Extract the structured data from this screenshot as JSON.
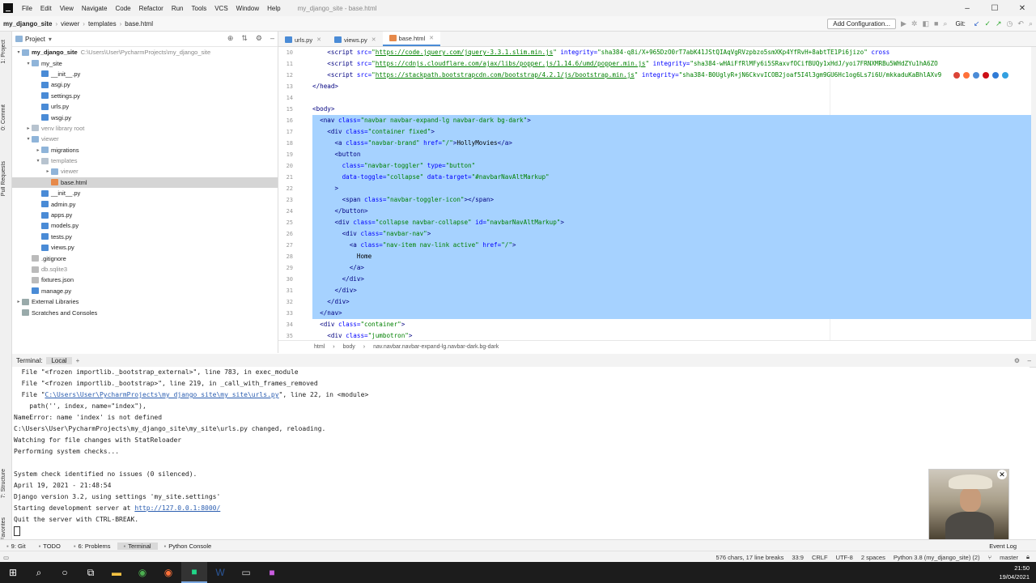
{
  "menubar": {
    "items": [
      "File",
      "Edit",
      "View",
      "Navigate",
      "Code",
      "Refactor",
      "Run",
      "Tools",
      "VCS",
      "Window",
      "Help"
    ],
    "window_title": "my_django_site - base.html"
  },
  "navbar": {
    "breadcrumbs": [
      "my_django_site",
      "viewer",
      "templates",
      "base.html"
    ],
    "add_config": "Add Configuration...",
    "git_label": "Git:"
  },
  "project_panel": {
    "title": "Project",
    "tree": [
      {
        "label": "my_django_site",
        "extra": "C:\\Users\\User\\PycharmProjects\\my_django_site",
        "indent": 0,
        "arrow": "▾",
        "icon": "folder",
        "bold": true
      },
      {
        "label": "my_site",
        "indent": 1,
        "arrow": "▾",
        "icon": "folder"
      },
      {
        "label": "__init__.py",
        "indent": 2,
        "arrow": "",
        "icon": "py"
      },
      {
        "label": "asgi.py",
        "indent": 2,
        "arrow": "",
        "icon": "py"
      },
      {
        "label": "settings.py",
        "indent": 2,
        "arrow": "",
        "icon": "py"
      },
      {
        "label": "urls.py",
        "indent": 2,
        "arrow": "",
        "icon": "py"
      },
      {
        "label": "wsgi.py",
        "indent": 2,
        "arrow": "",
        "icon": "py"
      },
      {
        "label": "venv library root",
        "indent": 1,
        "arrow": "▸",
        "icon": "folder grey",
        "muted": true
      },
      {
        "label": "viewer",
        "indent": 1,
        "arrow": "▾",
        "icon": "folder",
        "muted": true
      },
      {
        "label": "migrations",
        "indent": 2,
        "arrow": "▸",
        "icon": "folder"
      },
      {
        "label": "templates",
        "indent": 2,
        "arrow": "▾",
        "icon": "folder grey",
        "muted": true
      },
      {
        "label": "viewer",
        "indent": 3,
        "arrow": "▸",
        "icon": "folder",
        "muted": true
      },
      {
        "label": "base.html",
        "indent": 3,
        "arrow": "",
        "icon": "html",
        "selected": true
      },
      {
        "label": "__init__.py",
        "indent": 2,
        "arrow": "",
        "icon": "py"
      },
      {
        "label": "admin.py",
        "indent": 2,
        "arrow": "",
        "icon": "py"
      },
      {
        "label": "apps.py",
        "indent": 2,
        "arrow": "",
        "icon": "py"
      },
      {
        "label": "models.py",
        "indent": 2,
        "arrow": "",
        "icon": "py"
      },
      {
        "label": "tests.py",
        "indent": 2,
        "arrow": "",
        "icon": "py"
      },
      {
        "label": "views.py",
        "indent": 2,
        "arrow": "",
        "icon": "py"
      },
      {
        "label": ".gitignore",
        "indent": 1,
        "arrow": "",
        "icon": "file"
      },
      {
        "label": "db.sqlite3",
        "indent": 1,
        "arrow": "",
        "icon": "file",
        "muted": true
      },
      {
        "label": "fixtures.json",
        "indent": 1,
        "arrow": "",
        "icon": "file"
      },
      {
        "label": "manage.py",
        "indent": 1,
        "arrow": "",
        "icon": "py"
      },
      {
        "label": "External Libraries",
        "indent": 0,
        "arrow": "▸",
        "icon": "lib"
      },
      {
        "label": "Scratches and Consoles",
        "indent": 0,
        "arrow": "",
        "icon": "lib"
      }
    ]
  },
  "editor": {
    "tabs": [
      {
        "label": "urls.py",
        "active": false
      },
      {
        "label": "views.py",
        "active": false
      },
      {
        "label": "base.html",
        "active": true
      }
    ],
    "lines": [
      {
        "n": "10",
        "sel": false,
        "html": "    <span class='tag'>&lt;script </span><span class='attr'>src=</span><span class='str'>\"</span><span class='link'>https://code.jquery.com/jquery-3.3.1.slim.min.js</span><span class='str'>\"</span><span class='attr'> integrity=</span><span class='str'>\"sha384-q8i/X+965DzO0rT7abK41JStQIAqVgRVzpbzo5smXKp4YfRvH+8abtTE1Pi6jizo\"</span><span class='attr'> cross</span>"
      },
      {
        "n": "11",
        "sel": false,
        "html": "    <span class='tag'>&lt;script </span><span class='attr'>src=</span><span class='str'>\"</span><span class='link'>https://cdnjs.cloudflare.com/ajax/libs/popper.js/1.14.6/umd/popper.min.js</span><span class='str'>\"</span><span class='attr'> integrity=</span><span class='str'>\"sha384-wHAiFfRlMFy6i5SRaxvfOCifBUQy1xHdJ/yoi7FRNXMRBu5WHdZYu1hA6ZO</span>"
      },
      {
        "n": "12",
        "sel": false,
        "html": "    <span class='tag'>&lt;script </span><span class='attr'>src=</span><span class='str'>\"</span><span class='link'>https://stackpath.bootstrapcdn.com/bootstrap/4.2.1/js/bootstrap.min.js</span><span class='str'>\"</span><span class='attr'> integrity=</span><span class='str'>\"sha384-B0UglyR+jN6CkvvICOB2joaf5I4l3gm9GU6Hc1og6Ls7i6U/mkkaduKaBhlAXv9</span>"
      },
      {
        "n": "13",
        "sel": false,
        "html": "<span class='tag'>&lt;/head&gt;</span>"
      },
      {
        "n": "14",
        "sel": false,
        "html": ""
      },
      {
        "n": "15",
        "sel": false,
        "html": "<span class='tag'>&lt;body&gt;</span>"
      },
      {
        "n": "16",
        "sel": true,
        "html": "  <span class='tag'>&lt;nav </span><span class='attr'>class=</span><span class='str'>\"navbar navbar-expand-lg navbar-dark bg-dark\"</span><span class='tag'>&gt;</span>"
      },
      {
        "n": "17",
        "sel": true,
        "html": "    <span class='tag'>&lt;div </span><span class='attr'>class=</span><span class='str'>\"container fixed\"</span><span class='tag'>&gt;</span>"
      },
      {
        "n": "18",
        "sel": true,
        "html": "      <span class='tag'>&lt;a </span><span class='attr'>class=</span><span class='str'>\"navbar-brand\"</span><span class='attr'> href=</span><span class='str'>\"/\"</span><span class='tag'>&gt;</span><span class='txt'>HollyMovies</span><span class='tag'>&lt;/a&gt;</span>"
      },
      {
        "n": "19",
        "sel": true,
        "html": "      <span class='tag'>&lt;button</span>"
      },
      {
        "n": "20",
        "sel": true,
        "html": "        <span class='attr'>class=</span><span class='str'>\"navbar-toggler\"</span><span class='attr'> type=</span><span class='str'>\"button\"</span>"
      },
      {
        "n": "21",
        "sel": true,
        "html": "        <span class='attr'>data-toggle=</span><span class='str'>\"collapse\"</span><span class='attr'> data-target=</span><span class='str'>\"#navbarNavAltMarkup\"</span>"
      },
      {
        "n": "22",
        "sel": true,
        "html": "      <span class='tag'>&gt;</span>"
      },
      {
        "n": "23",
        "sel": true,
        "html": "        <span class='tag'>&lt;span </span><span class='attr'>class=</span><span class='str'>\"navbar-toggler-icon\"</span><span class='tag'>&gt;&lt;/span&gt;</span>"
      },
      {
        "n": "24",
        "sel": true,
        "html": "      <span class='tag'>&lt;/button&gt;</span>"
      },
      {
        "n": "25",
        "sel": true,
        "html": "      <span class='tag'>&lt;div </span><span class='attr'>class=</span><span class='str'>\"collapse navbar-collapse\"</span><span class='attr'> id=</span><span class='str'>\"navbarNavAltMarkup\"</span><span class='tag'>&gt;</span>"
      },
      {
        "n": "26",
        "sel": true,
        "html": "        <span class='tag'>&lt;div </span><span class='attr'>class=</span><span class='str'>\"navbar-nav\"</span><span class='tag'>&gt;</span>"
      },
      {
        "n": "27",
        "sel": true,
        "html": "          <span class='tag'>&lt;a </span><span class='attr'>class=</span><span class='str'>\"nav-item nav-link active\"</span><span class='attr'> href=</span><span class='str'>\"/\"</span><span class='tag'>&gt;</span>"
      },
      {
        "n": "28",
        "sel": true,
        "html": "            <span class='txt'>Home</span>"
      },
      {
        "n": "29",
        "sel": true,
        "html": "          <span class='tag'>&lt;/a&gt;</span>"
      },
      {
        "n": "30",
        "sel": true,
        "html": "        <span class='tag'>&lt;/div&gt;</span>"
      },
      {
        "n": "31",
        "sel": true,
        "html": "      <span class='tag'>&lt;/div&gt;</span>"
      },
      {
        "n": "32",
        "sel": true,
        "html": "    <span class='tag'>&lt;/div&gt;</span>"
      },
      {
        "n": "33",
        "sel": true,
        "html": "  <span class='tag'>&lt;/nav&gt;</span>"
      },
      {
        "n": "34",
        "sel": false,
        "html": "  <span class='tag'>&lt;div </span><span class='attr'>class=</span><span class='str'>\"container\"</span><span class='tag'>&gt;</span>"
      },
      {
        "n": "35",
        "sel": false,
        "html": "    <span class='tag'>&lt;div </span><span class='attr'>class=</span><span class='str'>\"jumbotron\"</span><span class='tag'>&gt;</span>"
      }
    ],
    "breadcrumb": [
      "html",
      "body",
      "nav.navbar.navbar-expand-lg.navbar-dark.bg-dark"
    ]
  },
  "terminal": {
    "title": "Terminal:",
    "tab": "Local",
    "lines": [
      "  File \"<frozen importlib._bootstrap_external>\", line 783, in exec_module",
      "  File \"<frozen importlib._bootstrap>\", line 219, in _call_with_frames_removed",
      "  File \"C:\\Users\\User\\PycharmProjects\\my_django_site\\my_site\\urls.py\", line 22, in <module>",
      "    path('', index, name=\"index\"),",
      "NameError: name 'index' is not defined",
      "C:\\Users\\User\\PycharmProjects\\my_django_site\\my_site\\urls.py changed, reloading.",
      "Watching for file changes with StatReloader",
      "Performing system checks...",
      "",
      "System check identified no issues (0 silenced).",
      "April 19, 2021 - 21:48:54",
      "Django version 3.2, using settings 'my_site.settings'",
      "Starting development server at http://127.0.0.1:8000/",
      "Quit the server with CTRL-BREAK."
    ]
  },
  "bottom_tools": [
    "9: Git",
    "TODO",
    "6: Problems",
    "Terminal",
    "Python Console"
  ],
  "bottom_right": "Event Log",
  "status": {
    "info": "576 chars, 17 line breaks",
    "position": "33:9",
    "line_sep": "CRLF",
    "encoding": "UTF-8",
    "indent": "2 spaces",
    "interpreter": "Python 3.8 (my_django_site) (2)",
    "branch": "master"
  },
  "taskbar": {
    "time": "21:50",
    "date": "19/04/2021"
  }
}
